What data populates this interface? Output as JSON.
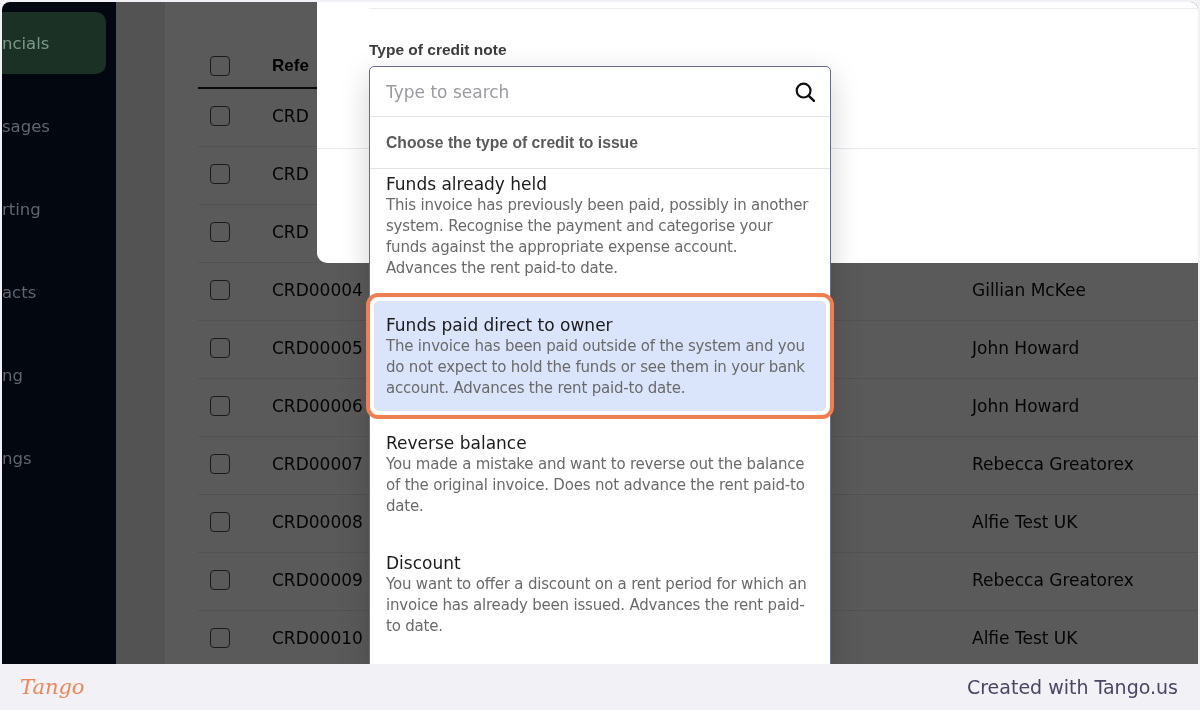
{
  "sidebar": {
    "items": [
      {
        "label": "ncials",
        "selected": true
      },
      {
        "label": "sages",
        "selected": false
      },
      {
        "label": "rting",
        "selected": false
      },
      {
        "label": "acts",
        "selected": false
      },
      {
        "label": "ng",
        "selected": false
      },
      {
        "label": "ngs",
        "selected": false
      }
    ]
  },
  "table": {
    "header_checkbox": {
      "checked": false
    },
    "columns": [
      {
        "label": "Refe"
      }
    ],
    "rows": [
      {
        "checked": false,
        "reference": "CRD"
      },
      {
        "checked": false,
        "reference": "CRD"
      },
      {
        "checked": false,
        "reference": "CRD"
      },
      {
        "checked": false,
        "reference": "CRD00004",
        "name": "Gillian McKee"
      },
      {
        "checked": false,
        "reference": "CRD00005",
        "name": "John Howard"
      },
      {
        "checked": false,
        "reference": "CRD00006",
        "name": "John Howard"
      },
      {
        "checked": false,
        "reference": "CRD00007",
        "name": "Rebecca Greatorex"
      },
      {
        "checked": false,
        "reference": "CRD00008",
        "name": "Alfie Test UK"
      },
      {
        "checked": false,
        "reference": "CRD00009",
        "name": "Rebecca Greatorex"
      },
      {
        "checked": false,
        "reference": "CRD00010",
        "name": "Alfie Test UK"
      }
    ]
  },
  "modal": {
    "field_label": "Type of credit note",
    "dropdown": {
      "search": {
        "placeholder": "Type to search"
      },
      "group_heading": "Choose the type of credit to issue",
      "options": [
        {
          "title": "Funds already held",
          "description": "This invoice has previously been paid, possibly in another system. Recognise the payment and categorise your funds against the appropriate expense account. Advances the rent paid-to date.",
          "selected": false
        },
        {
          "title": "Funds paid direct to owner",
          "description": "The invoice has been paid outside of the system and you do not expect to hold the funds or see them in your bank account. Advances the rent paid-to date.",
          "selected": true
        },
        {
          "title": "Reverse balance",
          "description": "You made a mistake and want to reverse out the balance of the original invoice. Does not advance the rent paid-to date.",
          "selected": false
        },
        {
          "title": "Discount",
          "description": "You want to offer a discount on a rent period for which an invoice has already been issued. Advances the rent paid-to date.",
          "selected": false
        }
      ]
    }
  },
  "footer": {
    "logo": "Tango",
    "credit": "Created with Tango.us"
  }
}
